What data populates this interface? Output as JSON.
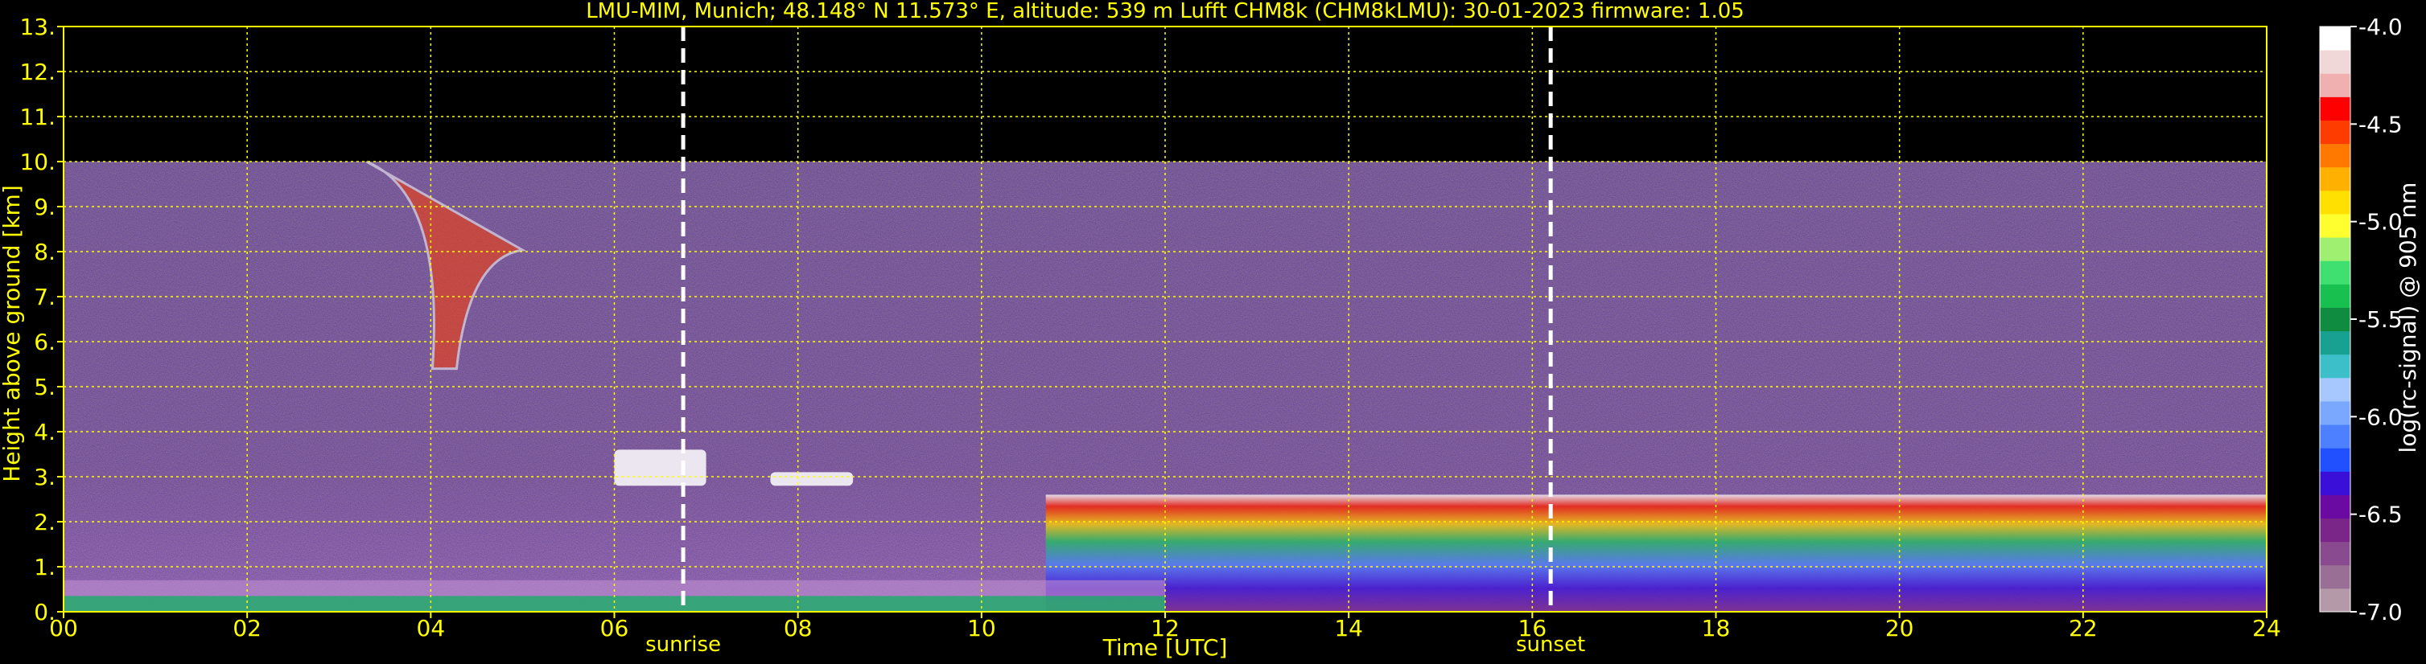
{
  "chart_data": {
    "type": "heatmap",
    "title": "LMU-MIM, Munich; 48.148° N 11.573° E, altitude: 539 m    Lufft CHM8k (CHM8kLMU): 30-01-2023    firmware: 1.05",
    "xlabel": "Time [UTC]",
    "ylabel": "Height above ground [km]",
    "xlim": [
      0,
      24
    ],
    "ylim": [
      0,
      13
    ],
    "x_ticks": [
      "00",
      "02",
      "04",
      "06",
      "08",
      "10",
      "12",
      "14",
      "16",
      "18",
      "20",
      "22",
      "24"
    ],
    "y_ticks": [
      "0.",
      "1.",
      "2.",
      "3.",
      "4.",
      "5.",
      "6.",
      "7.",
      "8.",
      "9.",
      "10.",
      "11.",
      "12.",
      "13."
    ],
    "grid": true,
    "data_ceiling_km": 10,
    "events": [
      {
        "label": "sunrise",
        "x": 6.75
      },
      {
        "label": "sunset",
        "x": 16.2
      }
    ],
    "colorbar": {
      "label": "log(rc-signal) @ 905 nm",
      "range": [
        -7.0,
        -4.0
      ],
      "ticks": [
        "-4.0",
        "-4.5",
        "-5.0",
        "-5.5",
        "-6.0",
        "-6.5",
        "-7.0"
      ],
      "colors": [
        "#b49aa8",
        "#9a6f96",
        "#8a4a90",
        "#7a2588",
        "#6a0aa0",
        "#3a0fd8",
        "#2050ff",
        "#4c80ff",
        "#7aa8ff",
        "#a6c8ff",
        "#3cbfc8",
        "#18a090",
        "#108c40",
        "#18c050",
        "#40e070",
        "#9ff070",
        "#ffff30",
        "#ffe000",
        "#ffb000",
        "#ff7800",
        "#ff3c00",
        "#ff0000",
        "#f0b0b0",
        "#f0d8d8",
        "#ffffff"
      ]
    },
    "features": [
      {
        "name": "cirrus fall streak",
        "x_range": [
          3.3,
          5.0
        ],
        "y_range": [
          5.4,
          10.0
        ]
      },
      {
        "name": "cloud layer",
        "x_range": [
          6.0,
          7.0
        ],
        "y_range": [
          2.8,
          3.6
        ]
      },
      {
        "name": "cloud layer",
        "x_range": [
          7.7,
          8.6
        ],
        "y_range": [
          2.8,
          3.1
        ]
      },
      {
        "name": "stratocumulus deck",
        "x_range": [
          10.7,
          24.0
        ],
        "y_range": [
          0.0,
          2.6
        ]
      },
      {
        "name": "aerosol boundary layer",
        "x_range": [
          0.0,
          12.0
        ],
        "y_range": [
          0.0,
          0.7
        ]
      }
    ]
  }
}
